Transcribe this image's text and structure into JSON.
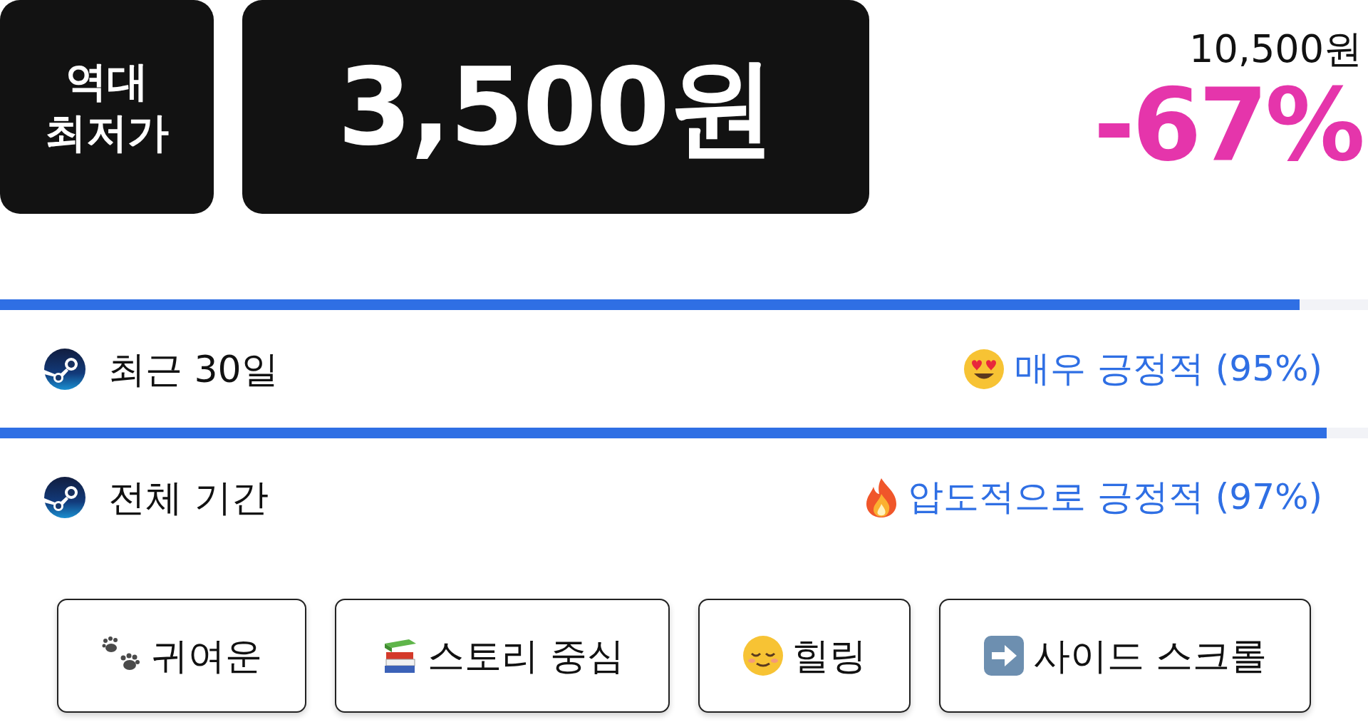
{
  "price_badge": {
    "label_lines": [
      "역대",
      "최저가"
    ],
    "price": "3,500원"
  },
  "original_price": "10,500원",
  "discount": "-67%",
  "reviews": [
    {
      "level": 0.95,
      "period": "최근 30일",
      "rating": "매우 긍정적 (95%)"
    },
    {
      "level": 0.97,
      "period": "전체 기간",
      "rating": "압도적으로 긍정적 (97%)"
    }
  ],
  "tags": [
    {
      "label": "귀여운"
    },
    {
      "label": "스토리 중심"
    },
    {
      "label": "힐링"
    },
    {
      "label": "사이드 스크롤"
    }
  ]
}
